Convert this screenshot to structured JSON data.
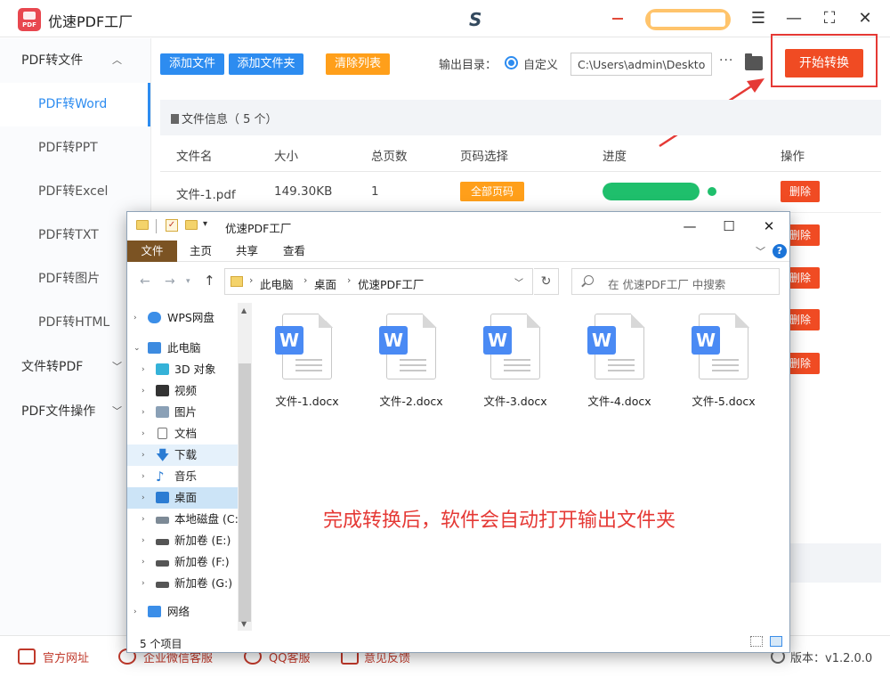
{
  "app": {
    "title": "优速PDF工厂",
    "logo_text": "PDF"
  },
  "sidebar": {
    "groups": [
      {
        "label": "PDF转文件",
        "expanded": true
      },
      {
        "label": "文件转PDF",
        "expanded": false
      },
      {
        "label": "PDF文件操作",
        "expanded": false
      }
    ],
    "items": [
      "PDF转Word",
      "PDF转PPT",
      "PDF转Excel",
      "PDF转TXT",
      "PDF转图片",
      "PDF转HTML"
    ],
    "active_item": "PDF转Word"
  },
  "toolbar": {
    "add_file": "添加文件",
    "add_folder": "添加文件夹",
    "clear_list": "清除列表",
    "output_label": "输出目录：",
    "output_option": "自定义",
    "output_path": "C:\\Users\\admin\\Deskto",
    "more": "···",
    "start": "开始转换"
  },
  "table": {
    "info_title": "文件信息（ 5 个）",
    "headers": [
      "文件名",
      "大小",
      "总页数",
      "页码选择",
      "进度",
      "操作"
    ],
    "rows": [
      {
        "name": "文件-1.pdf",
        "size": "149.30KB",
        "pages": "1",
        "page_select": "全部页码",
        "progress": 1.0,
        "action": "删除"
      }
    ],
    "delete_label": "删除"
  },
  "explorer": {
    "title": "优速PDF工厂",
    "ribbon_tabs": [
      "文件",
      "主页",
      "共享",
      "查看"
    ],
    "breadcrumbs": [
      "此电脑",
      "桌面",
      "优速PDF工厂"
    ],
    "search_placeholder": "在 优速PDF工厂 中搜索",
    "tree": [
      {
        "label": "WPS网盘",
        "level": 0,
        "icon": "cloud"
      },
      {
        "label": "此电脑",
        "level": 0,
        "icon": "computer",
        "expanded": true
      },
      {
        "label": "3D 对象",
        "level": 1,
        "icon": "3d"
      },
      {
        "label": "视频",
        "level": 1,
        "icon": "video"
      },
      {
        "label": "图片",
        "level": 1,
        "icon": "picture"
      },
      {
        "label": "文档",
        "level": 1,
        "icon": "document"
      },
      {
        "label": "下载",
        "level": 1,
        "icon": "download"
      },
      {
        "label": "音乐",
        "level": 1,
        "icon": "music"
      },
      {
        "label": "桌面",
        "level": 1,
        "icon": "desktop",
        "selected": true
      },
      {
        "label": "本地磁盘 (C:)",
        "level": 1,
        "icon": "drive-c"
      },
      {
        "label": "新加卷 (E:)",
        "level": 1,
        "icon": "drive"
      },
      {
        "label": "新加卷 (F:)",
        "level": 1,
        "icon": "drive"
      },
      {
        "label": "新加卷 (G:)",
        "level": 1,
        "icon": "drive"
      },
      {
        "label": "网络",
        "level": 0,
        "icon": "network"
      }
    ],
    "files": [
      "文件-1.docx",
      "文件-2.docx",
      "文件-3.docx",
      "文件-4.docx",
      "文件-5.docx"
    ],
    "file_icon_letter": "W",
    "status": "5 个项目"
  },
  "note": "完成转换后，软件会自动打开输出文件夹",
  "bottom": {
    "official_site": "官方网址",
    "wechat_support": "企业微信客服",
    "qq_support": "QQ客服",
    "feedback": "意见反馈",
    "version": "版本：v1.2.0.0"
  },
  "colors": {
    "primary": "#2d8cf0",
    "orange": "#ff9f1a",
    "danger": "#f04b23",
    "progress": "#1fbf6c",
    "highlight_red": "#e53935"
  }
}
